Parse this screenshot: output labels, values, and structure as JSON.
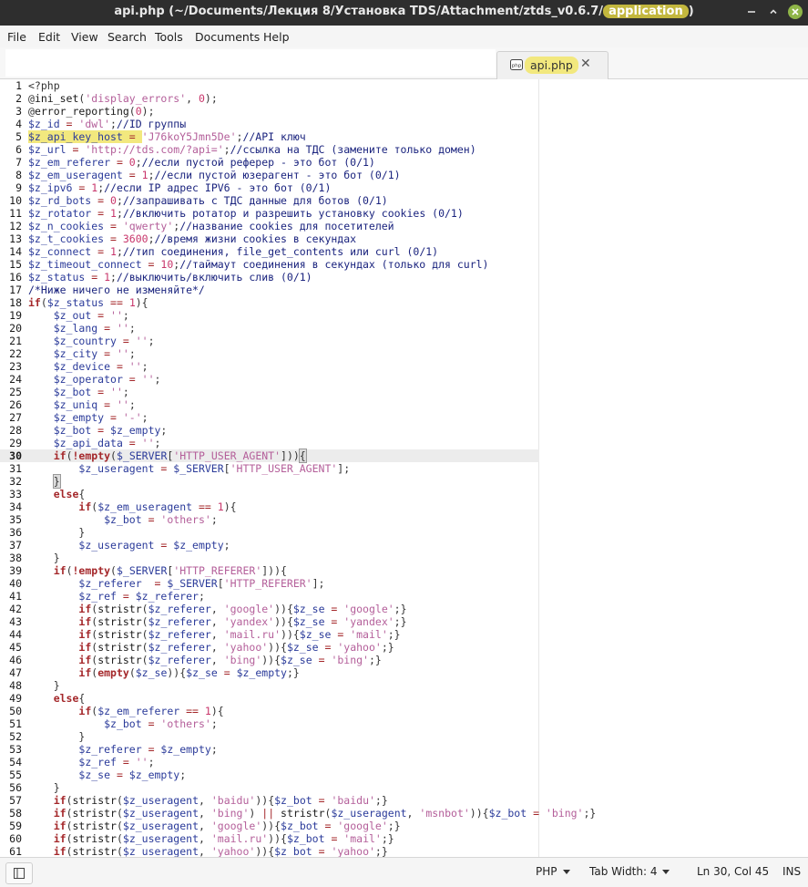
{
  "window": {
    "title_prefix": "api.php (~/Documents/Лекция 8/Установка TDS/Attachment/ztds_v0.6.7/",
    "title_highlight": "application",
    "title_suffix": ")"
  },
  "menu": [
    "File",
    "Edit",
    "View",
    "Search",
    "Tools",
    "Documents",
    "Help"
  ],
  "tab": {
    "label": "api.php",
    "close": "✕"
  },
  "editor": {
    "current_line": 30
  },
  "status": {
    "language": "PHP",
    "tab_width": "Tab Width:  4",
    "position": "Ln 30, Col 45",
    "mode": "INS"
  },
  "code_lines": [
    [
      [
        "p",
        "<?php"
      ]
    ],
    [
      [
        "p",
        "@"
      ],
      [
        "f",
        "ini_set"
      ],
      [
        "p",
        "("
      ],
      [
        "s",
        "'display_errors'"
      ],
      [
        "p",
        ", "
      ],
      [
        "n",
        "0"
      ],
      [
        "p",
        ");"
      ]
    ],
    [
      [
        "p",
        "@"
      ],
      [
        "f",
        "error_reporting"
      ],
      [
        "p",
        "("
      ],
      [
        "n",
        "0"
      ],
      [
        "p",
        ");"
      ]
    ],
    [
      [
        "v",
        "$z_id"
      ],
      [
        "o",
        " = "
      ],
      [
        "s",
        "'dwl'"
      ],
      [
        "p",
        ";"
      ],
      [
        "c",
        "//ID группы"
      ]
    ],
    [
      [
        "v",
        "$z_api_key_host",
        "hl"
      ],
      [
        "o",
        " = ",
        "hl"
      ],
      [
        "s",
        "'J76koY5Jmn5De'"
      ],
      [
        "p",
        ";"
      ],
      [
        "c",
        "//API ключ"
      ]
    ],
    [
      [
        "v",
        "$z_url"
      ],
      [
        "o",
        " = "
      ],
      [
        "s",
        "'http://tds.com/?api='"
      ],
      [
        "p",
        ";"
      ],
      [
        "c",
        "//ссылка на ТДС (замените только домен)"
      ]
    ],
    [
      [
        "v",
        "$z_em_referer"
      ],
      [
        "o",
        " = "
      ],
      [
        "n",
        "0"
      ],
      [
        "p",
        ";"
      ],
      [
        "c",
        "//если пустой реферер - это бот (0/1)"
      ]
    ],
    [
      [
        "v",
        "$z_em_useragent"
      ],
      [
        "o",
        " = "
      ],
      [
        "n",
        "1"
      ],
      [
        "p",
        ";"
      ],
      [
        "c",
        "//если пустой юзерагент - это бот (0/1)"
      ]
    ],
    [
      [
        "v",
        "$z_ipv6"
      ],
      [
        "o",
        " = "
      ],
      [
        "n",
        "1"
      ],
      [
        "p",
        ";"
      ],
      [
        "c",
        "//если IP адрес IPV6 - это бот (0/1)"
      ]
    ],
    [
      [
        "v",
        "$z_rd_bots"
      ],
      [
        "o",
        " = "
      ],
      [
        "n",
        "0"
      ],
      [
        "p",
        ";"
      ],
      [
        "c",
        "//запрашивать с ТДС данные для ботов (0/1)"
      ]
    ],
    [
      [
        "v",
        "$z_rotator"
      ],
      [
        "o",
        " = "
      ],
      [
        "n",
        "1"
      ],
      [
        "p",
        ";"
      ],
      [
        "c",
        "//включить ротатор и разрешить установку cookies (0/1)"
      ]
    ],
    [
      [
        "v",
        "$z_n_cookies"
      ],
      [
        "o",
        " = "
      ],
      [
        "s",
        "'qwerty'"
      ],
      [
        "p",
        ";"
      ],
      [
        "c",
        "//название cookies для посетителей"
      ]
    ],
    [
      [
        "v",
        "$z_t_cookies"
      ],
      [
        "o",
        " = "
      ],
      [
        "n",
        "3600"
      ],
      [
        "p",
        ";"
      ],
      [
        "c",
        "//время жизни cookies в секундах"
      ]
    ],
    [
      [
        "v",
        "$z_connect"
      ],
      [
        "o",
        " = "
      ],
      [
        "n",
        "1"
      ],
      [
        "p",
        ";"
      ],
      [
        "c",
        "//тип соединения, file_get_contents или curl (0/1)"
      ]
    ],
    [
      [
        "v",
        "$z_timeout_connect"
      ],
      [
        "o",
        " = "
      ],
      [
        "n",
        "10"
      ],
      [
        "p",
        ";"
      ],
      [
        "c",
        "//таймаут соединения в секундах (только для curl)"
      ]
    ],
    [
      [
        "v",
        "$z_status"
      ],
      [
        "o",
        " = "
      ],
      [
        "n",
        "1"
      ],
      [
        "p",
        ";"
      ],
      [
        "c",
        "//выключить/включить слив (0/1)"
      ]
    ],
    [
      [
        "c",
        "/*Ниже ничего не изменяйте*/"
      ]
    ],
    [
      [
        "k",
        "if"
      ],
      [
        "p",
        "("
      ],
      [
        "v",
        "$z_status"
      ],
      [
        "o",
        " == "
      ],
      [
        "n",
        "1"
      ],
      [
        "p",
        "){"
      ]
    ],
    [
      [
        "p",
        "    "
      ],
      [
        "v",
        "$z_out"
      ],
      [
        "o",
        " = "
      ],
      [
        "s",
        "''"
      ],
      [
        "p",
        ";"
      ]
    ],
    [
      [
        "p",
        "    "
      ],
      [
        "v",
        "$z_lang"
      ],
      [
        "o",
        " = "
      ],
      [
        "s",
        "''"
      ],
      [
        "p",
        ";"
      ]
    ],
    [
      [
        "p",
        "    "
      ],
      [
        "v",
        "$z_country"
      ],
      [
        "o",
        " = "
      ],
      [
        "s",
        "''"
      ],
      [
        "p",
        ";"
      ]
    ],
    [
      [
        "p",
        "    "
      ],
      [
        "v",
        "$z_city"
      ],
      [
        "o",
        " = "
      ],
      [
        "s",
        "''"
      ],
      [
        "p",
        ";"
      ]
    ],
    [
      [
        "p",
        "    "
      ],
      [
        "v",
        "$z_device"
      ],
      [
        "o",
        " = "
      ],
      [
        "s",
        "''"
      ],
      [
        "p",
        ";"
      ]
    ],
    [
      [
        "p",
        "    "
      ],
      [
        "v",
        "$z_operator"
      ],
      [
        "o",
        " = "
      ],
      [
        "s",
        "''"
      ],
      [
        "p",
        ";"
      ]
    ],
    [
      [
        "p",
        "    "
      ],
      [
        "v",
        "$z_bot"
      ],
      [
        "o",
        " = "
      ],
      [
        "s",
        "''"
      ],
      [
        "p",
        ";"
      ]
    ],
    [
      [
        "p",
        "    "
      ],
      [
        "v",
        "$z_uniq"
      ],
      [
        "o",
        " = "
      ],
      [
        "s",
        "''"
      ],
      [
        "p",
        ";"
      ]
    ],
    [
      [
        "p",
        "    "
      ],
      [
        "v",
        "$z_empty"
      ],
      [
        "o",
        " = "
      ],
      [
        "s",
        "'-'"
      ],
      [
        "p",
        ";"
      ]
    ],
    [
      [
        "p",
        "    "
      ],
      [
        "v",
        "$z_bot"
      ],
      [
        "o",
        " = "
      ],
      [
        "v",
        "$z_empty"
      ],
      [
        "p",
        ";"
      ]
    ],
    [
      [
        "p",
        "    "
      ],
      [
        "v",
        "$z_api_data"
      ],
      [
        "o",
        " = "
      ],
      [
        "s",
        "''"
      ],
      [
        "p",
        ";"
      ]
    ],
    [
      [
        "p",
        "    "
      ],
      [
        "k",
        "if"
      ],
      [
        "p",
        "("
      ],
      [
        "k",
        "!empty"
      ],
      [
        "p",
        "("
      ],
      [
        "v",
        "$_SERVER"
      ],
      [
        "p",
        "["
      ],
      [
        "s",
        "'HTTP_USER_AGENT'"
      ],
      [
        "p",
        "]))"
      ],
      [
        "p",
        "{",
        "br"
      ]
    ],
    [
      [
        "p",
        "        "
      ],
      [
        "v",
        "$z_useragent"
      ],
      [
        "o",
        " = "
      ],
      [
        "v",
        "$_SERVER"
      ],
      [
        "p",
        "["
      ],
      [
        "s",
        "'HTTP_USER_AGENT'"
      ],
      [
        "p",
        "];"
      ]
    ],
    [
      [
        "p",
        "    "
      ],
      [
        "p",
        "}",
        "br"
      ]
    ],
    [
      [
        "p",
        "    "
      ],
      [
        "k",
        "else"
      ],
      [
        "p",
        "{"
      ]
    ],
    [
      [
        "p",
        "        "
      ],
      [
        "k",
        "if"
      ],
      [
        "p",
        "("
      ],
      [
        "v",
        "$z_em_useragent"
      ],
      [
        "o",
        " == "
      ],
      [
        "n",
        "1"
      ],
      [
        "p",
        "){"
      ]
    ],
    [
      [
        "p",
        "            "
      ],
      [
        "v",
        "$z_bot"
      ],
      [
        "o",
        " = "
      ],
      [
        "s",
        "'others'"
      ],
      [
        "p",
        ";"
      ]
    ],
    [
      [
        "p",
        "        }"
      ]
    ],
    [
      [
        "p",
        "        "
      ],
      [
        "v",
        "$z_useragent"
      ],
      [
        "o",
        " = "
      ],
      [
        "v",
        "$z_empty"
      ],
      [
        "p",
        ";"
      ]
    ],
    [
      [
        "p",
        "    }"
      ]
    ],
    [
      [
        "p",
        "    "
      ],
      [
        "k",
        "if"
      ],
      [
        "p",
        "("
      ],
      [
        "k",
        "!empty"
      ],
      [
        "p",
        "("
      ],
      [
        "v",
        "$_SERVER"
      ],
      [
        "p",
        "["
      ],
      [
        "s",
        "'HTTP_REFERER'"
      ],
      [
        "p",
        "])){"
      ]
    ],
    [
      [
        "p",
        "        "
      ],
      [
        "v",
        "$z_referer"
      ],
      [
        "o",
        "  = "
      ],
      [
        "v",
        "$_SERVER"
      ],
      [
        "p",
        "["
      ],
      [
        "s",
        "'HTTP_REFERER'"
      ],
      [
        "p",
        "];"
      ]
    ],
    [
      [
        "p",
        "        "
      ],
      [
        "v",
        "$z_ref"
      ],
      [
        "o",
        " = "
      ],
      [
        "v",
        "$z_referer"
      ],
      [
        "p",
        ";"
      ]
    ],
    [
      [
        "p",
        "        "
      ],
      [
        "k",
        "if"
      ],
      [
        "p",
        "("
      ],
      [
        "f",
        "stristr"
      ],
      [
        "p",
        "("
      ],
      [
        "v",
        "$z_referer"
      ],
      [
        "p",
        ", "
      ],
      [
        "s",
        "'google'"
      ],
      [
        "p",
        ")){"
      ],
      [
        "v",
        "$z_se"
      ],
      [
        "o",
        " = "
      ],
      [
        "s",
        "'google'"
      ],
      [
        "p",
        ";}"
      ]
    ],
    [
      [
        "p",
        "        "
      ],
      [
        "k",
        "if"
      ],
      [
        "p",
        "("
      ],
      [
        "f",
        "stristr"
      ],
      [
        "p",
        "("
      ],
      [
        "v",
        "$z_referer"
      ],
      [
        "p",
        ", "
      ],
      [
        "s",
        "'yandex'"
      ],
      [
        "p",
        ")){"
      ],
      [
        "v",
        "$z_se"
      ],
      [
        "o",
        " = "
      ],
      [
        "s",
        "'yandex'"
      ],
      [
        "p",
        ";}"
      ]
    ],
    [
      [
        "p",
        "        "
      ],
      [
        "k",
        "if"
      ],
      [
        "p",
        "("
      ],
      [
        "f",
        "stristr"
      ],
      [
        "p",
        "("
      ],
      [
        "v",
        "$z_referer"
      ],
      [
        "p",
        ", "
      ],
      [
        "s",
        "'mail.ru'"
      ],
      [
        "p",
        ")){"
      ],
      [
        "v",
        "$z_se"
      ],
      [
        "o",
        " = "
      ],
      [
        "s",
        "'mail'"
      ],
      [
        "p",
        ";}"
      ]
    ],
    [
      [
        "p",
        "        "
      ],
      [
        "k",
        "if"
      ],
      [
        "p",
        "("
      ],
      [
        "f",
        "stristr"
      ],
      [
        "p",
        "("
      ],
      [
        "v",
        "$z_referer"
      ],
      [
        "p",
        ", "
      ],
      [
        "s",
        "'yahoo'"
      ],
      [
        "p",
        ")){"
      ],
      [
        "v",
        "$z_se"
      ],
      [
        "o",
        " = "
      ],
      [
        "s",
        "'yahoo'"
      ],
      [
        "p",
        ";}"
      ]
    ],
    [
      [
        "p",
        "        "
      ],
      [
        "k",
        "if"
      ],
      [
        "p",
        "("
      ],
      [
        "f",
        "stristr"
      ],
      [
        "p",
        "("
      ],
      [
        "v",
        "$z_referer"
      ],
      [
        "p",
        ", "
      ],
      [
        "s",
        "'bing'"
      ],
      [
        "p",
        ")){"
      ],
      [
        "v",
        "$z_se"
      ],
      [
        "o",
        " = "
      ],
      [
        "s",
        "'bing'"
      ],
      [
        "p",
        ";}"
      ]
    ],
    [
      [
        "p",
        "        "
      ],
      [
        "k",
        "if"
      ],
      [
        "p",
        "("
      ],
      [
        "k",
        "empty"
      ],
      [
        "p",
        "("
      ],
      [
        "v",
        "$z_se"
      ],
      [
        "p",
        "))"
      ],
      [
        "p",
        "{"
      ],
      [
        "v",
        "$z_se"
      ],
      [
        "o",
        " = "
      ],
      [
        "v",
        "$z_empty"
      ],
      [
        "p",
        ";}"
      ]
    ],
    [
      [
        "p",
        "    }"
      ]
    ],
    [
      [
        "p",
        "    "
      ],
      [
        "k",
        "else"
      ],
      [
        "p",
        "{"
      ]
    ],
    [
      [
        "p",
        "        "
      ],
      [
        "k",
        "if"
      ],
      [
        "p",
        "("
      ],
      [
        "v",
        "$z_em_referer"
      ],
      [
        "o",
        " == "
      ],
      [
        "n",
        "1"
      ],
      [
        "p",
        "){"
      ]
    ],
    [
      [
        "p",
        "            "
      ],
      [
        "v",
        "$z_bot"
      ],
      [
        "o",
        " = "
      ],
      [
        "s",
        "'others'"
      ],
      [
        "p",
        ";"
      ]
    ],
    [
      [
        "p",
        "        }"
      ]
    ],
    [
      [
        "p",
        "        "
      ],
      [
        "v",
        "$z_referer"
      ],
      [
        "o",
        " = "
      ],
      [
        "v",
        "$z_empty"
      ],
      [
        "p",
        ";"
      ]
    ],
    [
      [
        "p",
        "        "
      ],
      [
        "v",
        "$z_ref"
      ],
      [
        "o",
        " = "
      ],
      [
        "s",
        "''"
      ],
      [
        "p",
        ";"
      ]
    ],
    [
      [
        "p",
        "        "
      ],
      [
        "v",
        "$z_se"
      ],
      [
        "o",
        " = "
      ],
      [
        "v",
        "$z_empty"
      ],
      [
        "p",
        ";"
      ]
    ],
    [
      [
        "p",
        "    }"
      ]
    ],
    [
      [
        "p",
        "    "
      ],
      [
        "k",
        "if"
      ],
      [
        "p",
        "("
      ],
      [
        "f",
        "stristr"
      ],
      [
        "p",
        "("
      ],
      [
        "v",
        "$z_useragent"
      ],
      [
        "p",
        ", "
      ],
      [
        "s",
        "'baidu'"
      ],
      [
        "p",
        "))"
      ],
      [
        "p",
        "{"
      ],
      [
        "v",
        "$z_bot"
      ],
      [
        "o",
        " = "
      ],
      [
        "s",
        "'baidu'"
      ],
      [
        "p",
        ";}"
      ]
    ],
    [
      [
        "p",
        "    "
      ],
      [
        "k",
        "if"
      ],
      [
        "p",
        "("
      ],
      [
        "f",
        "stristr"
      ],
      [
        "p",
        "("
      ],
      [
        "v",
        "$z_useragent"
      ],
      [
        "p",
        ", "
      ],
      [
        "s",
        "'bing'"
      ],
      [
        "p",
        ")"
      ],
      [
        "o",
        " || "
      ],
      [
        "f",
        "stristr"
      ],
      [
        "p",
        "("
      ],
      [
        "v",
        "$z_useragent"
      ],
      [
        "p",
        ", "
      ],
      [
        "s",
        "'msnbot'"
      ],
      [
        "p",
        "))"
      ],
      [
        "p",
        "{"
      ],
      [
        "v",
        "$z_bot"
      ],
      [
        "o",
        " = "
      ],
      [
        "s",
        "'bing'"
      ],
      [
        "p",
        ";}"
      ]
    ],
    [
      [
        "p",
        "    "
      ],
      [
        "k",
        "if"
      ],
      [
        "p",
        "("
      ],
      [
        "f",
        "stristr"
      ],
      [
        "p",
        "("
      ],
      [
        "v",
        "$z_useragent"
      ],
      [
        "p",
        ", "
      ],
      [
        "s",
        "'google'"
      ],
      [
        "p",
        "))"
      ],
      [
        "p",
        "{"
      ],
      [
        "v",
        "$z_bot"
      ],
      [
        "o",
        " = "
      ],
      [
        "s",
        "'google'"
      ],
      [
        "p",
        ";}"
      ]
    ],
    [
      [
        "p",
        "    "
      ],
      [
        "k",
        "if"
      ],
      [
        "p",
        "("
      ],
      [
        "f",
        "stristr"
      ],
      [
        "p",
        "("
      ],
      [
        "v",
        "$z_useragent"
      ],
      [
        "p",
        ", "
      ],
      [
        "s",
        "'mail.ru'"
      ],
      [
        "p",
        "))"
      ],
      [
        "p",
        "{"
      ],
      [
        "v",
        "$z_bot"
      ],
      [
        "o",
        " = "
      ],
      [
        "s",
        "'mail'"
      ],
      [
        "p",
        ";}"
      ]
    ],
    [
      [
        "p",
        "    "
      ],
      [
        "k",
        "if"
      ],
      [
        "p",
        "("
      ],
      [
        "f",
        "stristr"
      ],
      [
        "p",
        "("
      ],
      [
        "v",
        "$z_useragent"
      ],
      [
        "p",
        ", "
      ],
      [
        "s",
        "'yahoo'"
      ],
      [
        "p",
        "))"
      ],
      [
        "p",
        "{"
      ],
      [
        "v",
        "$z_bot"
      ],
      [
        "o",
        " = "
      ],
      [
        "s",
        "'yahoo'"
      ],
      [
        "p",
        ";}"
      ]
    ]
  ]
}
